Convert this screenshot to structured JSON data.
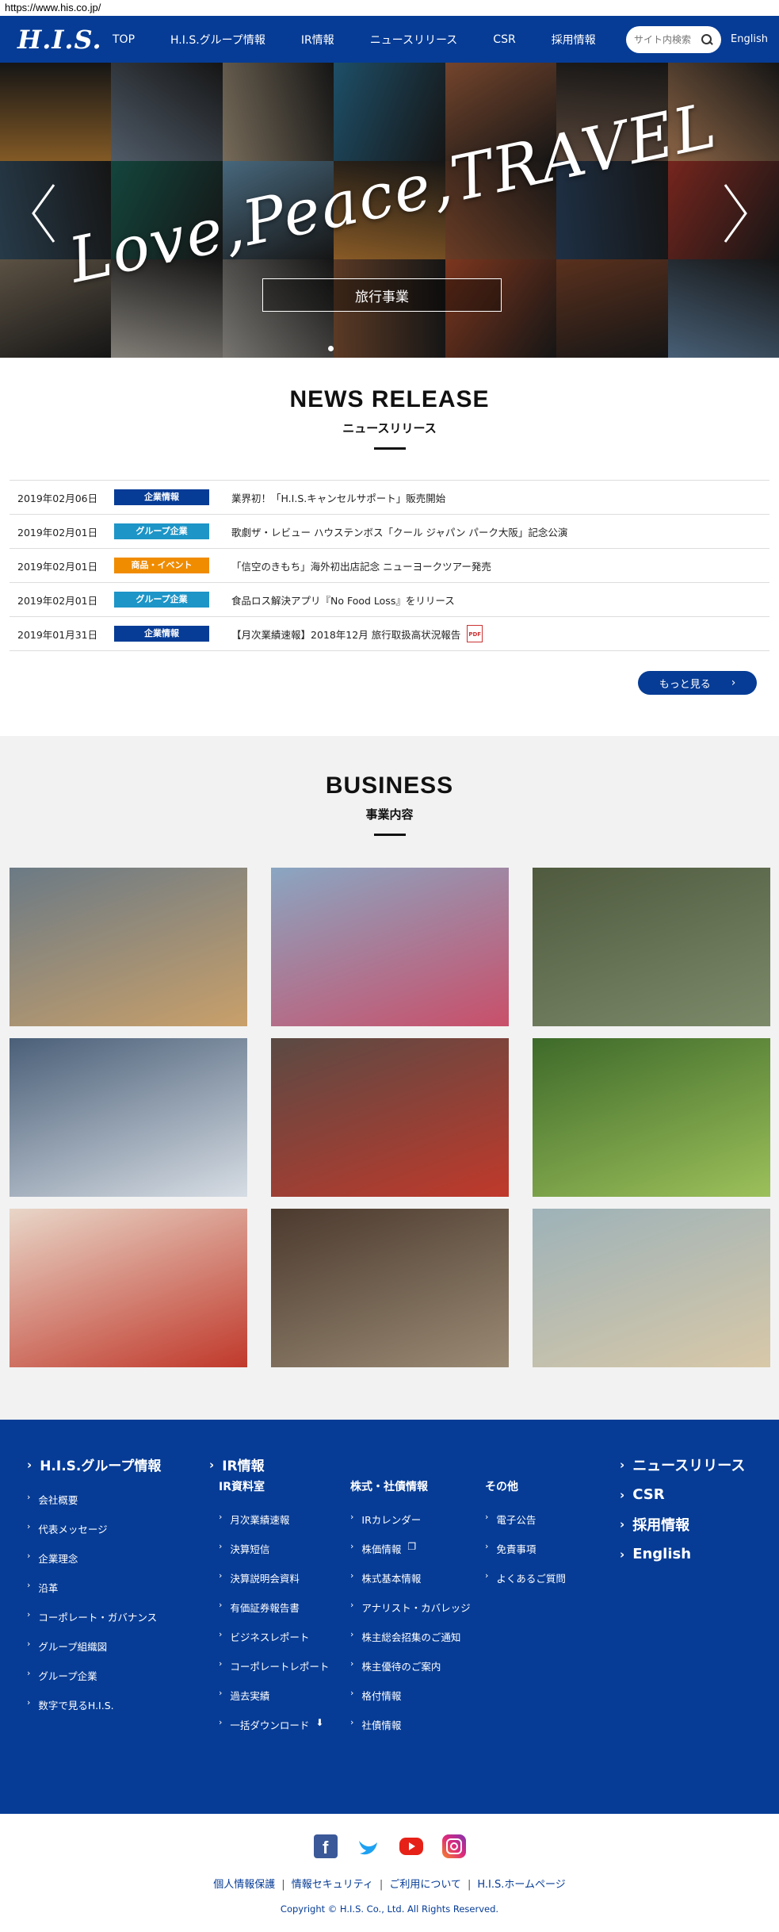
{
  "browser": {
    "url": "https://www.his.co.jp/"
  },
  "header": {
    "logo": "H.I.S.",
    "nav": [
      "TOP",
      "H.I.S.グループ情報",
      "IR情報",
      "ニュースリリース",
      "CSR",
      "採用情報"
    ],
    "search_placeholder": "サイト内検索",
    "english": "English"
  },
  "hero": {
    "title": "Love,Peace,TRAVEL",
    "badge": "旅行事業",
    "tile_colors": [
      "#c98a3a",
      "#7a8ca0",
      "#b7a58a",
      "#2e7aa0",
      "#b36a45",
      "#8a6d5a",
      "#d59a6b",
      "#3c5a70",
      "#1e6b5e",
      "#6e9fbf",
      "#d28b3b",
      "#a35d3a",
      "#2f4a6a",
      "#b53a2e",
      "#8c7d68",
      "#c8c2b8",
      "#b9b5ae",
      "#8d5a3a",
      "#c0542f",
      "#8a4b2e",
      "#6f93b6"
    ]
  },
  "news": {
    "title_en": "NEWS RELEASE",
    "title_jp": "ニュースリリース",
    "items": [
      {
        "date": "2019年02月06日",
        "tag": "企業情報",
        "tag_color": "#063c96",
        "text": "業界初！「H.I.S.キャンセルサポート」販売開始"
      },
      {
        "date": "2019年02月01日",
        "tag": "グループ企業",
        "tag_color": "#1d95c7",
        "text": "歌劇ザ・レビュー ハウステンボス「クール ジャパン パーク大阪」記念公演"
      },
      {
        "date": "2019年02月01日",
        "tag": "商品・イベント",
        "tag_color": "#f08c00",
        "text": "「信空のきもち」海外初出店記念 ニューヨークツアー発売"
      },
      {
        "date": "2019年02月01日",
        "tag": "グループ企業",
        "tag_color": "#1d95c7",
        "text": "食品ロス解決アプリ『No Food Loss』をリリース"
      },
      {
        "date": "2019年01月31日",
        "tag": "企業情報",
        "tag_color": "#063c96",
        "text": "【月次業績速報】2018年12月 旅行取扱高状況報告"
      }
    ],
    "more": "もっと見る",
    "pdf_label": "PDF"
  },
  "business": {
    "title_en": "BUSINESS",
    "title_jp": "事業内容",
    "card_colors": [
      [
        "#6b7a85",
        "#c9a06a"
      ],
      [
        "#8aa6c2",
        "#c94f6a"
      ],
      [
        "#4f5a3e",
        "#7c8a6a"
      ],
      [
        "#4a5f78",
        "#d7dde4"
      ],
      [
        "#5a4a44",
        "#c0392b"
      ],
      [
        "#3e6a2a",
        "#9cc05a"
      ],
      [
        "#e8d6c8",
        "#c0392b"
      ],
      [
        "#4b3a2e",
        "#9a8a74"
      ],
      [
        "#9db2b8",
        "#d8c8a8"
      ]
    ]
  },
  "footer": {
    "group": {
      "heading": "H.I.S.グループ情報",
      "items": [
        "会社概要",
        "代表メッセージ",
        "企業理念",
        "沿革",
        "コーポレート・ガバナンス",
        "グループ組織図",
        "グループ企業",
        "数字で見るH.I.S."
      ]
    },
    "ir": {
      "heading": "IR情報",
      "room": {
        "heading": "IR資料室",
        "items": [
          "月次業績速報",
          "決算短信",
          "決算説明会資料",
          "有価証券報告書",
          "ビジネスレポート",
          "コーポレートレポート",
          "過去実績",
          "一括ダウンロード"
        ]
      },
      "stock": {
        "heading": "株式・社債情報",
        "items": [
          "IRカレンダー",
          "株価情報",
          "株式基本情報",
          "アナリスト・カバレッジ",
          "株主総会招集のご通知",
          "株主優待のご案内",
          "格付情報",
          "社債情報"
        ]
      },
      "other": {
        "heading": "その他",
        "items": [
          "電子公告",
          "免責事項",
          "よくあるご質問"
        ]
      }
    },
    "right": [
      "ニュースリリース",
      "CSR",
      "採用情報",
      "English"
    ]
  },
  "bottom": {
    "links": [
      "個人情報保護",
      "情報セキュリティ",
      "ご利用について",
      "H.I.S.ホームページ"
    ],
    "copyright": "Copyright © H.I.S. Co., Ltd. All Rights Reserved.",
    "social": [
      {
        "name": "facebook",
        "color": "#3b5998"
      },
      {
        "name": "twitter",
        "color": "#1da1f2"
      },
      {
        "name": "youtube",
        "color": "#e62117"
      },
      {
        "name": "instagram",
        "color": "#c13584"
      }
    ]
  }
}
